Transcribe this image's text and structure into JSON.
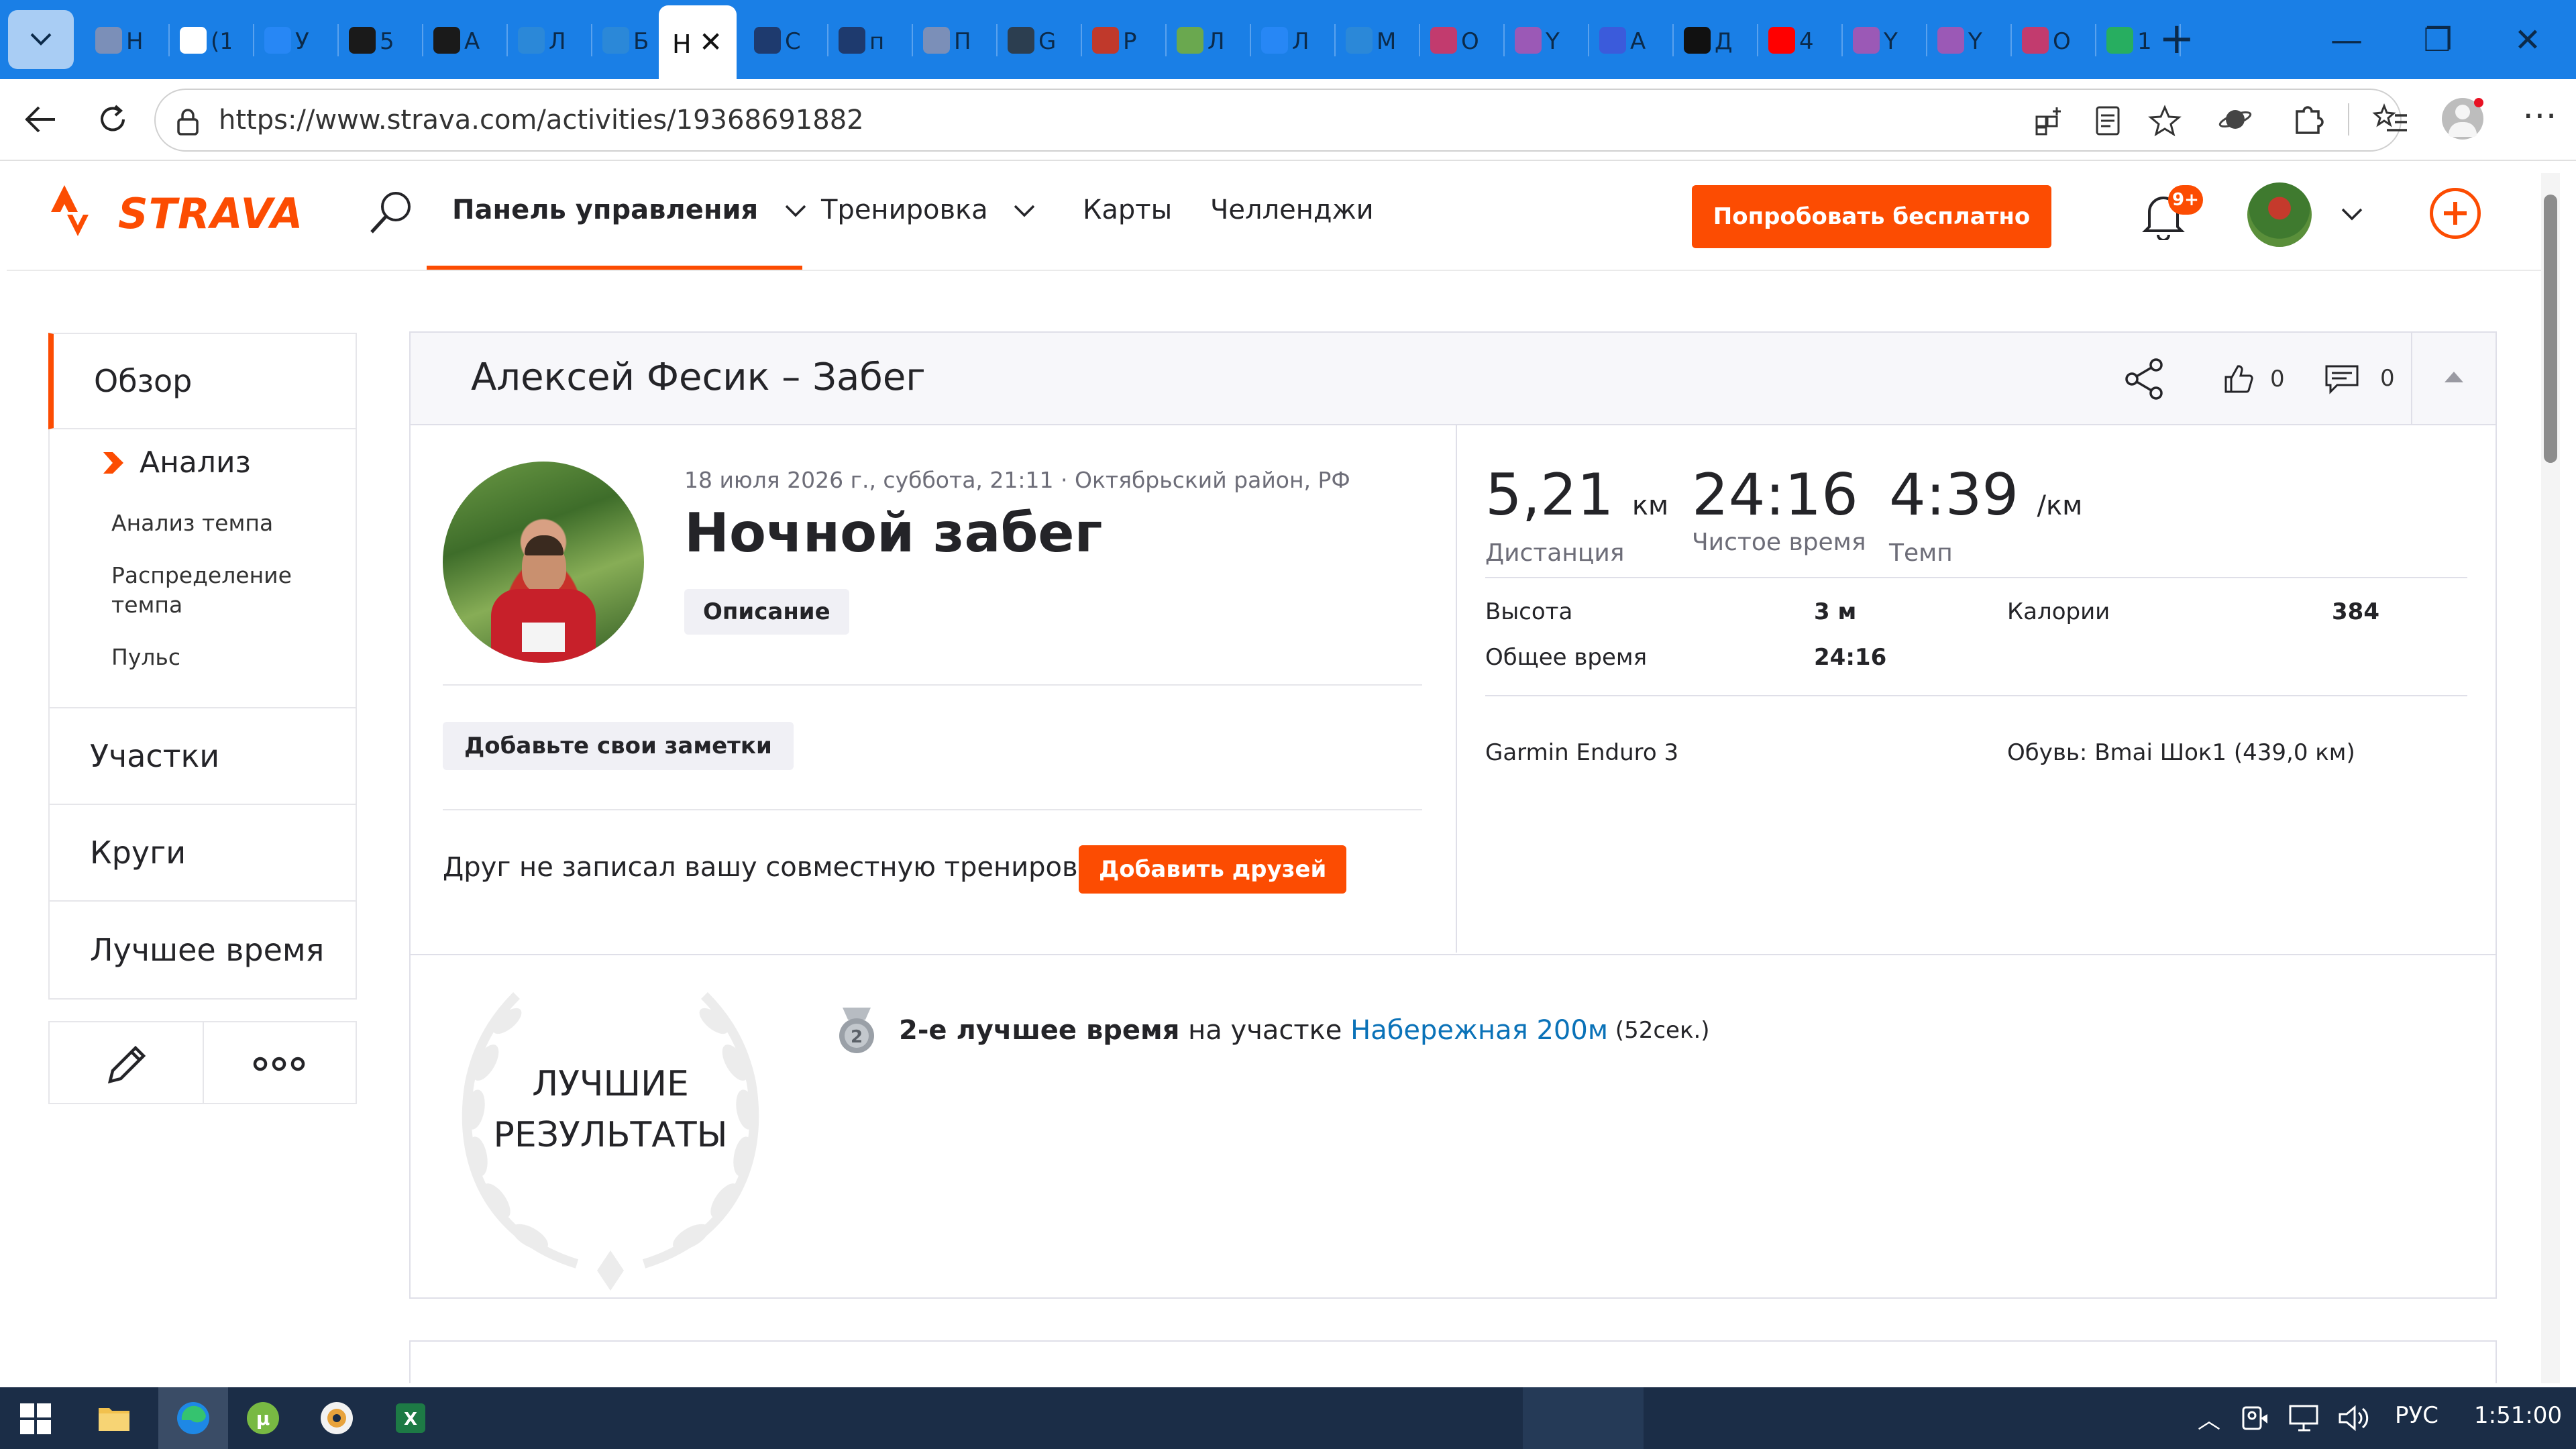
{
  "browser": {
    "active_tab_title": "Н",
    "tabs": [
      {
        "title": "Н",
        "color": "#7b8fb8"
      },
      {
        "title": "(1",
        "color": "#ffffff"
      },
      {
        "title": "У",
        "color": "#2787f5"
      },
      {
        "title": "5",
        "color": "#1a1a1a"
      },
      {
        "title": "А",
        "color": "#1a1a1a"
      },
      {
        "title": "Л",
        "color": "#2b88d8"
      },
      {
        "title": "Б",
        "color": "#2b88d8"
      },
      {
        "title": "С",
        "color": "#1e3a6e"
      },
      {
        "title": "п",
        "color": "#1e3a6e"
      },
      {
        "title": "П",
        "color": "#7b8fb8"
      },
      {
        "title": "G",
        "color": "#2c3e50"
      },
      {
        "title": "Р",
        "color": "#c0392b"
      },
      {
        "title": "Л",
        "color": "#6aa84f"
      },
      {
        "title": "Л",
        "color": "#2787f5"
      },
      {
        "title": "М",
        "color": "#2b88d8"
      },
      {
        "title": "О",
        "color": "#c23b6e"
      },
      {
        "title": "Y",
        "color": "#9b59b6"
      },
      {
        "title": "А",
        "color": "#3b5bdb"
      },
      {
        "title": "Д",
        "color": "#111111"
      },
      {
        "title": "4",
        "color": "#ff0000"
      },
      {
        "title": "Y",
        "color": "#9b59b6"
      },
      {
        "title": "Y",
        "color": "#9b59b6"
      },
      {
        "title": "О",
        "color": "#c23b6e"
      },
      {
        "title": "1",
        "color": "#27ae60"
      }
    ],
    "url": "https://www.strava.com/activities/19368691882"
  },
  "strava": {
    "logo": "STRAVA",
    "nav": {
      "dashboard": "Панель управления",
      "training": "Тренировка",
      "maps": "Карты",
      "challenges": "Челленджи"
    },
    "try_free": "Попробовать бесплатно",
    "notifications_badge": "9+",
    "brand_color": "#fc4c02"
  },
  "sidebar": {
    "overview": "Обзор",
    "analysis": "Анализ",
    "analysis_links": [
      "Анализ темпа",
      "Распределение темпа",
      "Пульс"
    ],
    "segments": "Участки",
    "laps": "Круги",
    "best_efforts": "Лучшее время"
  },
  "activity": {
    "header_title": "Алексей Фесик – Забег",
    "kudos": "0",
    "comments": "0",
    "date_location": "18 июля 2026 г., суббота, 21:11 · Октябрьский район, РФ",
    "title": "Ночной забег",
    "description_btn": "Описание",
    "notes_btn": "Добавьте свои заметки",
    "friend_question": "Друг не записал вашу совместную тренировку?",
    "add_friends_btn": "Добавить друзей",
    "stats": {
      "distance_value": "5,21",
      "distance_unit": "км",
      "distance_label": "Дистанция",
      "moving_time_value": "24:16",
      "moving_time_label": "Чистое время",
      "pace_value": "4:39",
      "pace_unit": "/км",
      "pace_label": "Темп",
      "elevation_label": "Высота",
      "elevation_value": "3 м",
      "calories_label": "Калории",
      "calories_value": "384",
      "elapsed_label": "Общее время",
      "elapsed_value": "24:16",
      "device": "Garmin Enduro 3",
      "shoes": "Обувь: Bmai Шок1 (439,0 км)"
    },
    "best_results": {
      "wreath_line1": "ЛУЧШИЕ",
      "wreath_line2": "РЕЗУЛЬТАТЫ",
      "medal_rank": "2",
      "achievement_strong": "2-е лучшее время",
      "achievement_mid": " на участке ",
      "segment_name": "Набережная 200м",
      "segment_time": " (52сек.)"
    }
  },
  "taskbar": {
    "lang": "РУС",
    "time": "1:51:00"
  }
}
